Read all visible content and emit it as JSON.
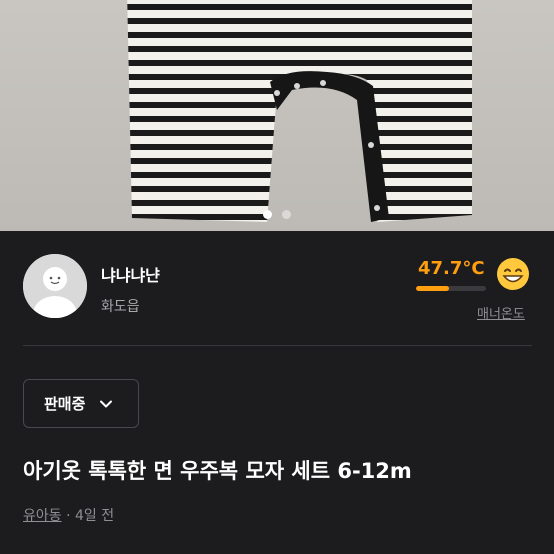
{
  "photo": {
    "page_index": 0,
    "page_count": 2
  },
  "seller": {
    "nickname": "냐냐냐냔",
    "location": "화도읍",
    "manner_temp": "47.7°C",
    "manner_temp_fraction": 0.477,
    "manner_label": "매너온도",
    "emoji": "smile-face"
  },
  "status": {
    "label": "판매중"
  },
  "product": {
    "title": "아기옷 톡톡한 면 우주복 모자 세트 6-12m",
    "category": "유아동",
    "time": "4일 전",
    "separator": " · "
  },
  "colors": {
    "accent": "#ff9f10",
    "background": "#1c1c1e"
  }
}
